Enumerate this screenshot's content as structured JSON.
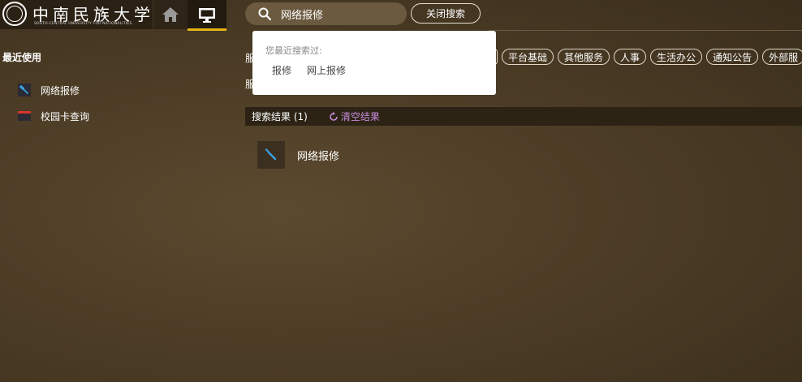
{
  "header": {
    "logo": {
      "name_cn": "中南民族大学",
      "name_en": "SOUTH-CENTRAL UNIVERSITY FOR NATIONALITIES"
    },
    "nav": [
      {
        "icon": "home-icon"
      },
      {
        "icon": "desktop-icon",
        "active": true
      }
    ],
    "search": {
      "value": "网络报修",
      "icon": "search-icon"
    },
    "close_search_label": "关闭搜索"
  },
  "sidebar": {
    "title": "最近使用",
    "items": [
      {
        "label": "网络报修",
        "icon": "wrench-icon"
      },
      {
        "label": "校园卡查询",
        "icon": "card-icon"
      }
    ]
  },
  "filters": {
    "row1_label": "服",
    "row2_label": "服",
    "categories": [
      "平台基础",
      "其他服务",
      "人事",
      "生活办公",
      "通知公告",
      "外部服"
    ]
  },
  "search_history": {
    "hint": "您最近搜索过:",
    "items": [
      "报修",
      "网上报修"
    ]
  },
  "results": {
    "label": "搜索结果 (1)",
    "clear_label": "清空结果",
    "items": [
      {
        "label": "网络报修",
        "icon": "wrench-icon"
      }
    ]
  },
  "colors": {
    "accent": "#e3b514",
    "clear_link": "#c58bd8",
    "wrench": "#3aa0e0",
    "card_red": "#d9342b"
  }
}
